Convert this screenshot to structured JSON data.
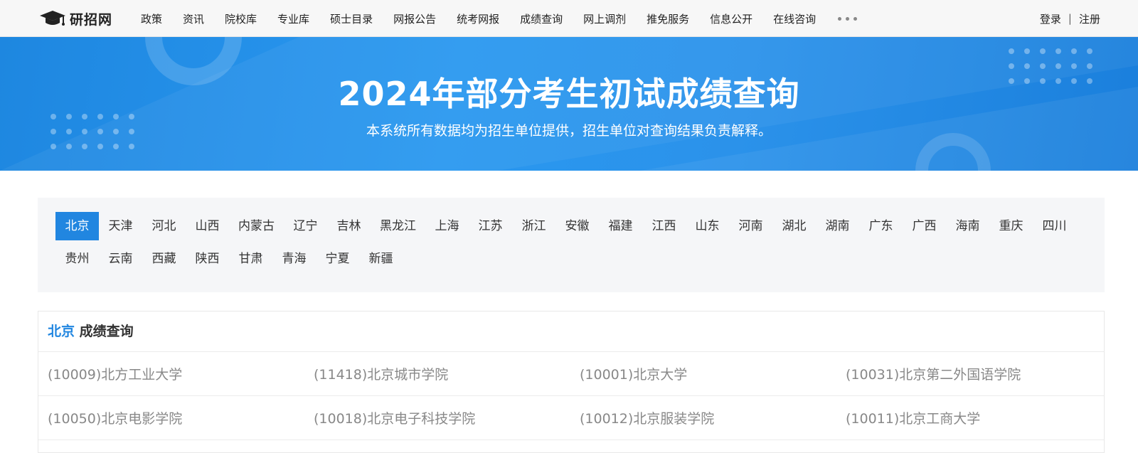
{
  "header": {
    "logo_text": "研招网",
    "nav": [
      "政策",
      "资讯",
      "院校库",
      "专业库",
      "硕士目录",
      "网报公告",
      "统考网报",
      "成绩查询",
      "网上调剂",
      "推免服务",
      "信息公开",
      "在线咨询"
    ],
    "auth": {
      "login": "登录",
      "separator": "|",
      "register": "注册"
    }
  },
  "banner": {
    "title": "2024年部分考生初试成绩查询",
    "subtitle": "本系统所有数据均为招生单位提供，招生单位对查询结果负责解释。"
  },
  "provinces": {
    "active": "北京",
    "rows": [
      [
        "北京",
        "天津",
        "河北",
        "山西",
        "内蒙古",
        "辽宁",
        "吉林",
        "黑龙江",
        "上海",
        "江苏",
        "浙江",
        "安徽",
        "福建",
        "江西",
        "山东",
        "河南",
        "湖北",
        "湖南",
        "广东",
        "广西",
        "海南",
        "重庆",
        "四川"
      ],
      [
        "贵州",
        "云南",
        "西藏",
        "陕西",
        "甘肃",
        "青海",
        "宁夏",
        "新疆"
      ]
    ]
  },
  "results": {
    "region": "北京",
    "heading_suffix": "成绩查询",
    "schools": [
      [
        "(10009)北方工业大学",
        "(11418)北京城市学院",
        "(10001)北京大学",
        "(10031)北京第二外国语学院"
      ],
      [
        "(10050)北京电影学院",
        "(10018)北京电子科技学院",
        "(10012)北京服装学院",
        "(10011)北京工商大学"
      ]
    ]
  },
  "colors": {
    "accent": "#2186e0",
    "banner": "#2a98f0"
  }
}
